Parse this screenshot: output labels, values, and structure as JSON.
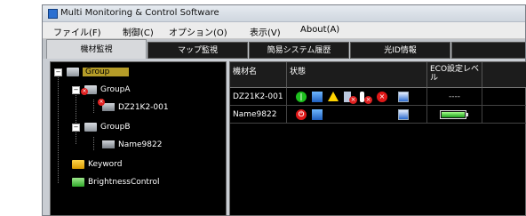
{
  "window": {
    "title": "Multi Monitoring & Control Software"
  },
  "menu": [
    "ファイル(F)",
    "制御(C)",
    "オプション(O)",
    "表示(V)",
    "About(A)"
  ],
  "tabs": [
    {
      "label": "機材監視",
      "active": true
    },
    {
      "label": "マップ監視",
      "active": false
    },
    {
      "label": "簡易システム履歴",
      "active": false
    },
    {
      "label": "光ID情報",
      "active": false
    }
  ],
  "tree": {
    "nodes": [
      {
        "label": "Group",
        "icon": "folder-grey",
        "selected": true
      },
      {
        "label": "GroupA",
        "icon": "folder-grey",
        "error": true
      },
      {
        "label": "DZ21K2-001",
        "icon": "monitor-icon",
        "error": true
      },
      {
        "label": "GroupB",
        "icon": "folder-grey"
      },
      {
        "label": "Name9822",
        "icon": "monitor-icon"
      },
      {
        "label": "Keyword",
        "icon": "folder-yellow"
      },
      {
        "label": "BrightnessControl",
        "icon": "folder-green"
      }
    ]
  },
  "grid": {
    "columns": [
      "機材名",
      "状態",
      "ECO設定レベル"
    ],
    "rows": [
      {
        "name": "DZ21K2-001",
        "status": [
          "power-on-icon",
          "network-icon",
          "warning-icon",
          "filter-icon",
          "temperature-icon",
          "error-icon",
          "monitor-icon"
        ],
        "eco": "----"
      },
      {
        "name": "Name9822",
        "status": [
          "power-off-icon",
          "network-icon",
          "monitor-icon"
        ],
        "eco_level": 1.0
      }
    ]
  },
  "colors": {
    "selected": "#b59c28",
    "power_on": "#1ec01e",
    "error": "#e02020",
    "battery": "#1da01d"
  }
}
